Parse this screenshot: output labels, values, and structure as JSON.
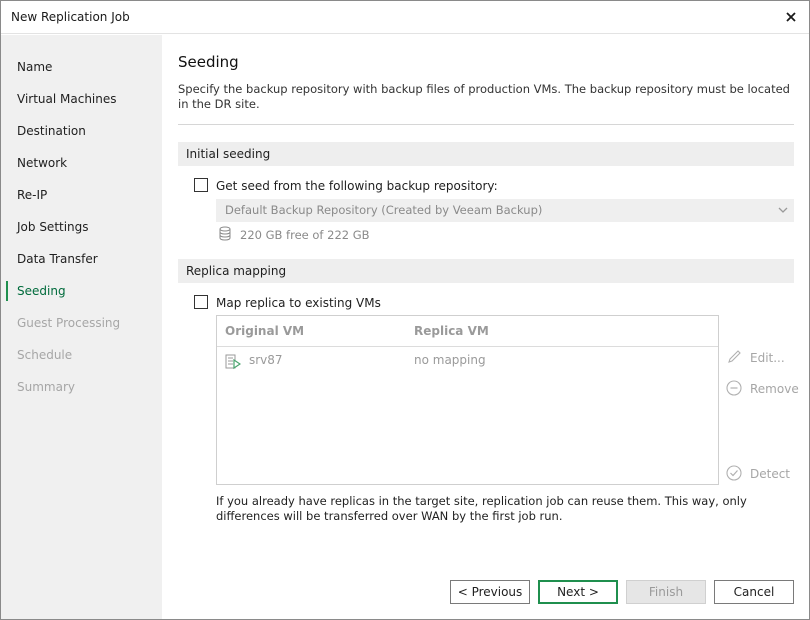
{
  "window": {
    "title": "New Replication Job"
  },
  "sidebar": {
    "items": [
      {
        "label": "Name",
        "state": "normal"
      },
      {
        "label": "Virtual Machines",
        "state": "normal"
      },
      {
        "label": "Destination",
        "state": "normal"
      },
      {
        "label": "Network",
        "state": "normal"
      },
      {
        "label": "Re-IP",
        "state": "normal"
      },
      {
        "label": "Job Settings",
        "state": "normal"
      },
      {
        "label": "Data Transfer",
        "state": "normal"
      },
      {
        "label": "Seeding",
        "state": "active"
      },
      {
        "label": "Guest Processing",
        "state": "disabled"
      },
      {
        "label": "Schedule",
        "state": "disabled"
      },
      {
        "label": "Summary",
        "state": "disabled"
      }
    ]
  },
  "page": {
    "title": "Seeding",
    "description": "Specify the backup repository with backup files of production VMs. The backup repository must be located in the DR site."
  },
  "initial_seeding": {
    "header": "Initial seeding",
    "checkbox_label": "Get seed from the following backup repository:",
    "checked": false,
    "repository": "Default Backup Repository (Created by Veeam Backup)",
    "free_space": "220 GB free of 222 GB"
  },
  "replica_mapping": {
    "header": "Replica mapping",
    "checkbox_label": "Map replica to existing VMs",
    "checked": false,
    "columns": [
      "Original VM",
      "Replica VM"
    ],
    "rows": [
      {
        "original_vm": "srv87",
        "replica_vm": "no mapping"
      }
    ],
    "actions": {
      "edit": "Edit...",
      "remove": "Remove",
      "detect": "Detect"
    },
    "help_text": "If you already have replicas in the target site, replication job can reuse them. This way, only differences will be transferred over WAN by the first job run."
  },
  "buttons": {
    "previous": "< Previous",
    "next": "Next >",
    "finish": "Finish",
    "cancel": "Cancel"
  },
  "colors": {
    "accent": "#1f8f4e",
    "active_text": "#006b3c",
    "sidebar_bg": "#f0f0f0"
  }
}
